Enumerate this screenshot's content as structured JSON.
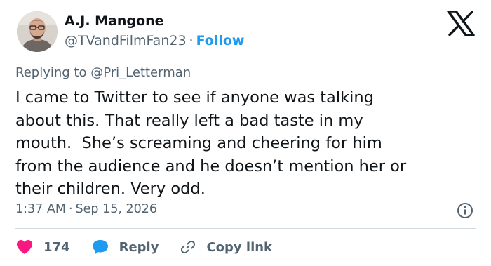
{
  "author": {
    "name": "A.J. Mangone",
    "handle": "@TVandFilmFan23",
    "separator": "·",
    "follow_label": "Follow"
  },
  "brand_icon": "x-logo-icon",
  "replying": {
    "prefix": "Replying to",
    "mention": "@Pri_Letterman"
  },
  "tweet": {
    "text": "I came to Twitter to see if anyone was talking\nabout this. That really left a bad taste in my\nmouth.  She’s screaming and cheering for him\nfrom the audience and he doesn’t mention her or\ntheir children. Very odd."
  },
  "meta": {
    "time": "1:37 AM",
    "separator": "·",
    "date": "Sep 15, 2026",
    "info_icon": "info-icon"
  },
  "actions": {
    "like_count": "174",
    "like_icon": "heart-icon",
    "reply_label": "Reply",
    "reply_icon": "speech-bubble-icon",
    "copy_label": "Copy link",
    "copy_icon": "link-icon"
  },
  "colors": {
    "text": "#0f1419",
    "secondary": "#536471",
    "accent": "#1d9bf0",
    "like": "#f91880",
    "divider": "#cfd9de"
  }
}
